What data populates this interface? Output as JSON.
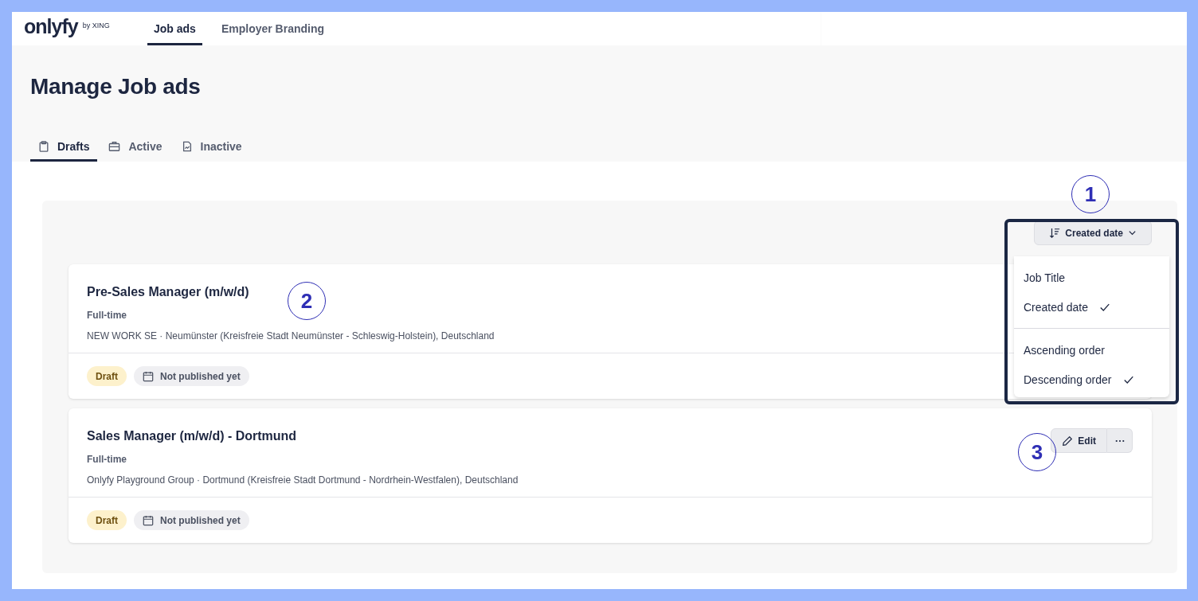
{
  "header": {
    "logo": "onlyfy",
    "logo_suffix": "by XING",
    "nav": [
      {
        "label": "Job ads",
        "selected": true
      },
      {
        "label": "Employer Branding",
        "selected": false
      }
    ]
  },
  "page_title": "Manage Job ads",
  "tabs": [
    {
      "label": "Drafts",
      "selected": true
    },
    {
      "label": "Active",
      "selected": false
    },
    {
      "label": "Inactive",
      "selected": false
    }
  ],
  "sort": {
    "label": "Created date",
    "menu": [
      [
        {
          "label": "Job Title",
          "checked": false
        },
        {
          "label": "Created date",
          "checked": true
        }
      ],
      [
        {
          "label": "Ascending order",
          "checked": false
        },
        {
          "label": "Descending order",
          "checked": true
        }
      ]
    ]
  },
  "job_ads": [
    {
      "title": "Pre-Sales Manager (m/w/d)",
      "employment_type": "Full-time",
      "location": "NEW WORK SE · Neumünster (Kreisfreie Stadt Neumünster - Schleswig-Holstein), Deutschland",
      "status": "Draft",
      "publish_state": "Not published yet"
    },
    {
      "title": "Sales Manager (m/w/d) - Dortmund",
      "employment_type": "Full-time",
      "location": "Onlyfy Playground Group · Dortmund (Kreisfreie Stadt Dortmund - Nordrhein-Westfalen), Deutschland",
      "status": "Draft",
      "publish_state": "Not published yet",
      "edit_label": "Edit"
    }
  ],
  "callouts": [
    {
      "label": "1"
    },
    {
      "label": "2"
    },
    {
      "label": "3"
    }
  ]
}
